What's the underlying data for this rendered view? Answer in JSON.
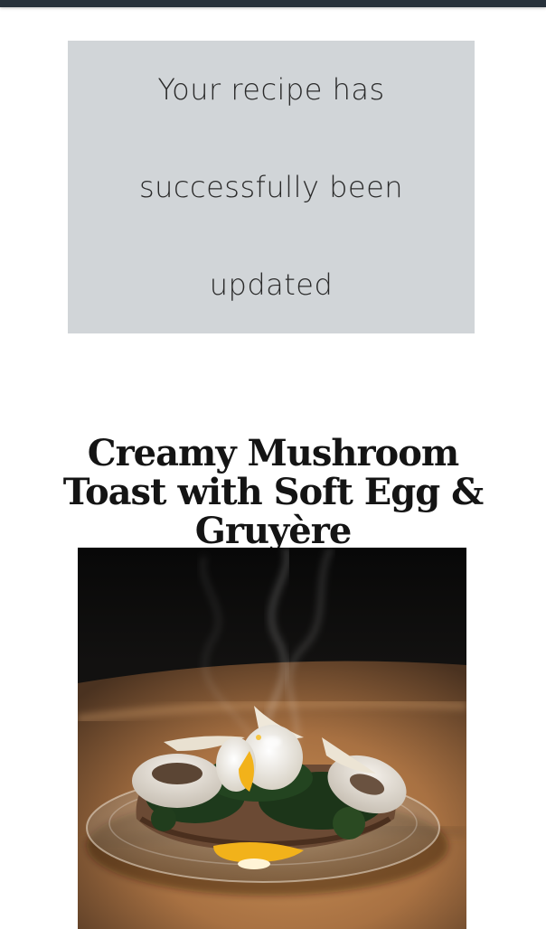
{
  "flash": {
    "message": "Your recipe has successfully been updated"
  },
  "recipe": {
    "title": "Creamy Mushroom Toast with Soft Egg & Gruyère",
    "image": {
      "icon": "recipe-photo",
      "colors": {
        "background": "#0c0c0c",
        "table": "#b07a45",
        "egg_yolk": "#f2b21a"
      }
    }
  },
  "colors": {
    "top_bar": "#27313a",
    "flash_background": "#d1d5d8",
    "title_text": "#141414"
  }
}
